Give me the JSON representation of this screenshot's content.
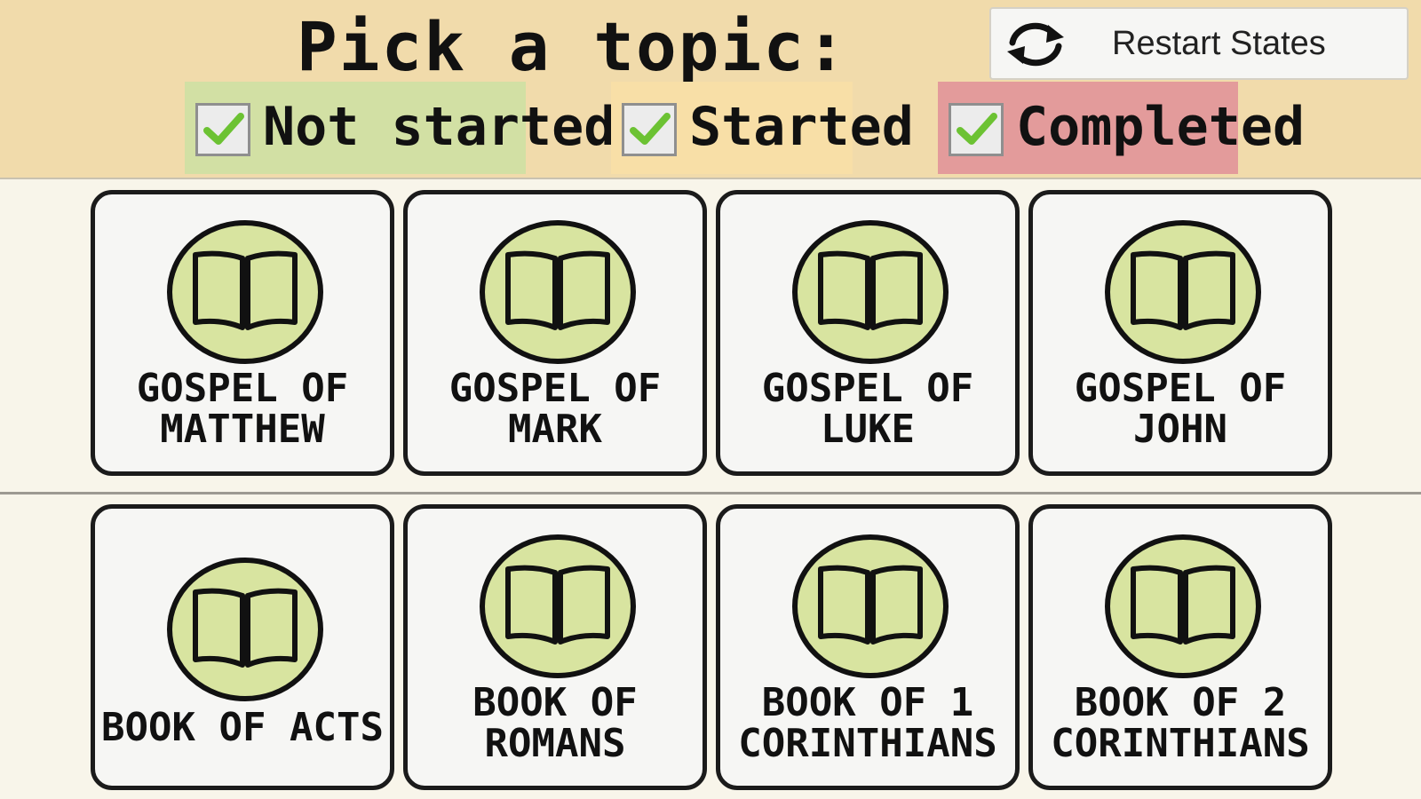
{
  "header": {
    "title": "Pick a topic:",
    "restart_label": "Restart States",
    "restart_icon": "refresh-icon"
  },
  "filters": [
    {
      "label": "Not started",
      "checked": true,
      "color": "#d2e0a4"
    },
    {
      "label": "Started",
      "checked": true,
      "color": "#f8dfa7"
    },
    {
      "label": "Completed",
      "checked": true,
      "color": "#e39b9b"
    }
  ],
  "topics": [
    {
      "label": "GOSPEL OF\nMATTHEW",
      "icon": "open-book-icon"
    },
    {
      "label": "GOSPEL OF\nMARK",
      "icon": "open-book-icon"
    },
    {
      "label": "GOSPEL OF\nLUKE",
      "icon": "open-book-icon"
    },
    {
      "label": "GOSPEL OF\nJOHN",
      "icon": "open-book-icon"
    },
    {
      "label": "BOOK OF ACTS",
      "icon": "open-book-icon"
    },
    {
      "label": "BOOK OF\nROMANS",
      "icon": "open-book-icon"
    },
    {
      "label": "BOOK OF 1\nCORINTHIANS",
      "icon": "open-book-icon"
    },
    {
      "label": "BOOK OF 2\nCORINTHIANS",
      "icon": "open-book-icon"
    }
  ],
  "colors": {
    "header_bg": "#f1dbab",
    "page_bg": "#f8f5ea",
    "icon_fill": "#d8e4a0",
    "tile_border": "#1b1b1b",
    "check_green": "#6cc233"
  }
}
